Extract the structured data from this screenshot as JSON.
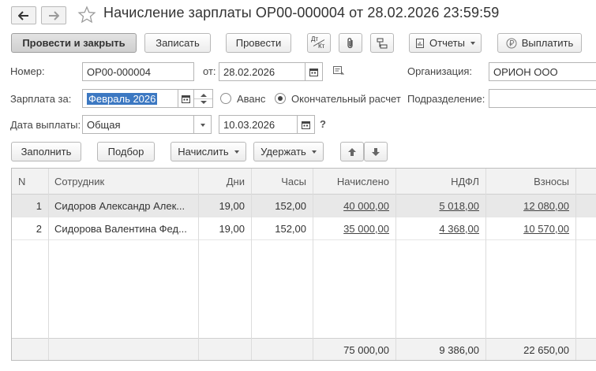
{
  "window": {
    "title": "Начисление зарплаты ОР00-000004 от 28.02.2026 23:59:59"
  },
  "toolbar": {
    "post_close": "Провести и закрыть",
    "save": "Записать",
    "post": "Провести",
    "dtkt_top": "Дт",
    "dtkt_bottom": "Кт",
    "reports": "Отчеты",
    "pay": "Выплатить"
  },
  "form": {
    "number_label": "Номер:",
    "number_value": "ОР00-000004",
    "from_label": "от:",
    "date_value": "28.02.2026",
    "org_label": "Организация:",
    "org_value": "ОРИОН ООО",
    "salary_label": "Зарплата за:",
    "salary_value": "Февраль 2026",
    "radio_advance": "Аванс",
    "radio_final": "Окончательный расчет",
    "radio_selected": "final",
    "division_label": "Подразделение:",
    "division_value": "",
    "pay_date_label": "Дата выплаты:",
    "pay_date_type": "Общая",
    "pay_date_value": "10.03.2026",
    "help": "?"
  },
  "table_toolbar": {
    "fill": "Заполнить",
    "select": "Подбор",
    "accrue": "Начислить",
    "withhold": "Удержать"
  },
  "table": {
    "headers": [
      "N",
      "Сотрудник",
      "Дни",
      "Часы",
      "Начислено",
      "НДФЛ",
      "Взносы"
    ],
    "rows": [
      {
        "n": "1",
        "employee": "Сидоров Александр Алек...",
        "days": "19,00",
        "hours": "152,00",
        "accrued": "40 000,00",
        "ndfl": "5 018,00",
        "contributions": "12 080,00"
      },
      {
        "n": "2",
        "employee": "Сидорова Валентина Фед...",
        "days": "19,00",
        "hours": "152,00",
        "accrued": "35 000,00",
        "ndfl": "4 368,00",
        "contributions": "10 570,00"
      }
    ],
    "totals": {
      "accrued": "75 000,00",
      "ndfl": "9 386,00",
      "contributions": "22 650,00"
    }
  },
  "colors": {
    "selection": "#3c78c2",
    "row_selected": "#e8e8e8",
    "header_bg": "#f2f2f2"
  }
}
